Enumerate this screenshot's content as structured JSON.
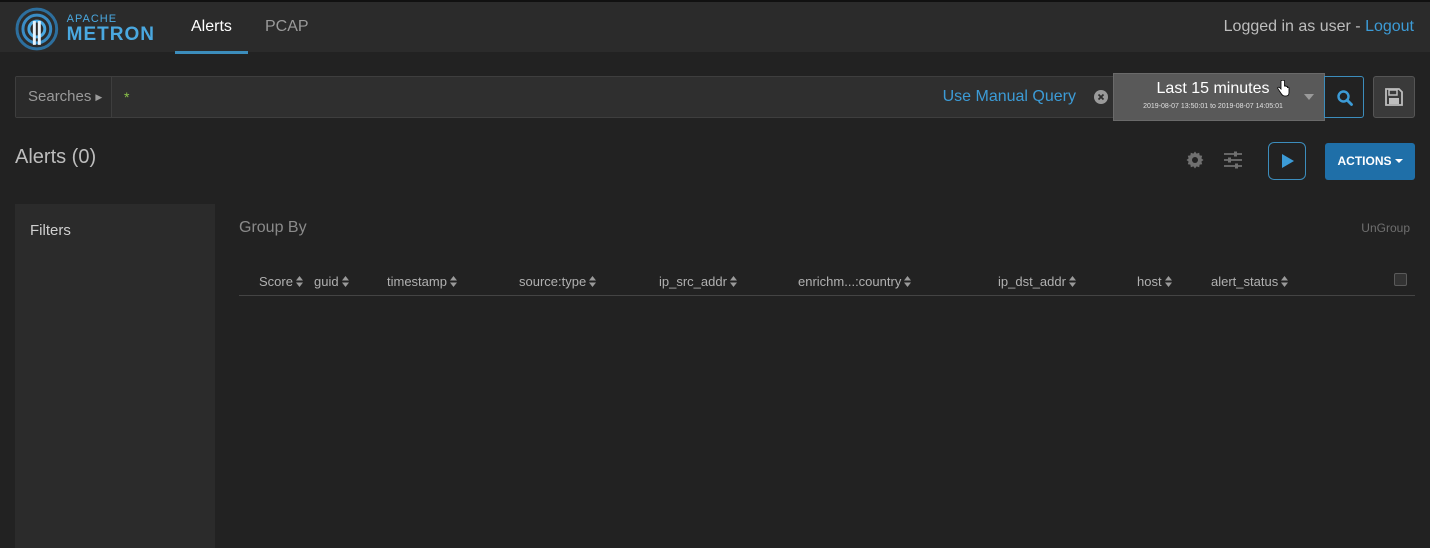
{
  "brand": {
    "line1": "APACHE",
    "line2": "METRON",
    "color": "#4aa8e0"
  },
  "nav": {
    "tabs": [
      {
        "label": "Alerts",
        "active": true
      },
      {
        "label": "PCAP",
        "active": false
      }
    ],
    "login_prefix": "Logged in as user - ",
    "logout_label": "Logout"
  },
  "search": {
    "searches_label": "Searches",
    "query": "*",
    "manual_query_label": "Use Manual Query"
  },
  "time_range": {
    "label": "Last 15 minutes",
    "range": "2019-08-07 13:50:01 to 2019-08-07 14:05:01"
  },
  "title_row": {
    "title": "Alerts (0)",
    "actions_label": "ACTIONS"
  },
  "filters": {
    "title": "Filters"
  },
  "grouping": {
    "group_by_label": "Group By",
    "ungroup_label": "UnGroup"
  },
  "table": {
    "columns": [
      "Score",
      "guid",
      "timestamp",
      "source:type",
      "ip_src_addr",
      "enrichm...:country",
      "ip_dst_addr",
      "host",
      "alert_status"
    ],
    "rows": []
  },
  "colors": {
    "accent": "#3c8dbc",
    "link": "#3c9bd6",
    "query_text": "#8bc34a",
    "actions_bg": "#1f6fa8"
  },
  "icons": {
    "logo": "metron-logo-icon",
    "clear": "clear-circle-icon",
    "search": "search-icon",
    "save": "save-floppy-icon",
    "settings": "gear-icon",
    "columns": "sliders-icon",
    "play": "play-icon",
    "sort": "sort-icon"
  }
}
